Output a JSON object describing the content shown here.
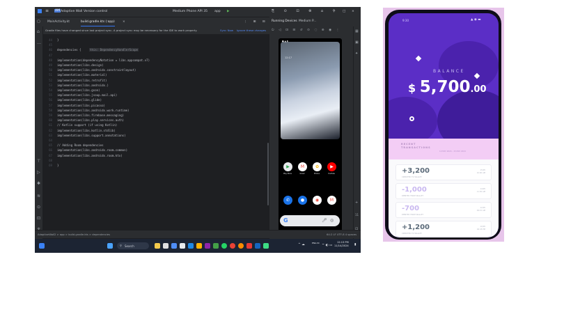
{
  "ide": {
    "titlebar": {
      "project_badge": "AM",
      "project_name": "Adaptive Wall",
      "vcs": "Version control",
      "device": "Medium Phone API 35",
      "run_config": "app"
    },
    "tabs": [
      {
        "label": "MainActivity.kt"
      },
      {
        "label": "build.gradle.kts (:app)"
      }
    ],
    "notification": {
      "message": "Gradle files have changed since last project sync. A project sync may be necessary for the IDE to work properly.",
      "sync_now": "Sync Now",
      "ignore": "Ignore these changes"
    },
    "code": [
      {
        "n": "44",
        "t": "}"
      },
      {
        "n": "45",
        "t": ""
      },
      {
        "n": "46",
        "t": "dependencies {",
        "hint": "this: DependencyHandlerScope"
      },
      {
        "n": "47",
        "t": ""
      },
      {
        "n": "48",
        "t": "    implementation(dependencyNotation = libs.appcompat.v7)"
      },
      {
        "n": "49",
        "t": "    implementation(libs.design)"
      },
      {
        "n": "50",
        "t": "    implementation(libs.androidx.constraintlayout)"
      },
      {
        "n": "51",
        "t": "    implementation(libs.material)"
      },
      {
        "n": "52",
        "t": "    implementation(libs.retrofit)"
      },
      {
        "n": "53",
        "t": "    implementation(libs.androidx.)"
      },
      {
        "n": "54",
        "t": "    implementation(libs.gson)"
      },
      {
        "n": "55",
        "t": "    implementation(libs.jsoup.mail.api)"
      },
      {
        "n": "56",
        "t": "    implementation(libs.glide)"
      },
      {
        "n": "57",
        "t": "    implementation(libs.picasso)"
      },
      {
        "n": "58",
        "t": "    implementation(libs.androidx.work.runtime)"
      },
      {
        "n": "59",
        "t": "    implementation(libs.firebase.messaging)"
      },
      {
        "n": "60",
        "t": "    implementation(libs.play.services.auth)"
      },
      {
        "n": "61",
        "t": "    // Kotlin support (if using Kotlin)"
      },
      {
        "n": "62",
        "t": "    implementation(libs.kotlin.stdlib)"
      },
      {
        "n": "63",
        "t": "    implementation(libs.support.annotations)"
      },
      {
        "n": "64",
        "t": ""
      },
      {
        "n": "65",
        "t": "    // Adding Room dependencies"
      },
      {
        "n": "66",
        "t": "    implementation(libs.androidx.room.common)"
      },
      {
        "n": "67",
        "t": "    implementation(libs.androidx.room.ktx)"
      },
      {
        "n": "68",
        "t": ""
      },
      {
        "n": "69",
        "t": "}"
      }
    ],
    "running_devices": {
      "label": "Running Devices",
      "device_tab": "Medium P..."
    },
    "emulator": {
      "clock": "12:17",
      "apps_row1": [
        {
          "label": "Play Store",
          "color": "#e8eaed"
        },
        {
          "label": "Gmail",
          "color": "#ffffff"
        },
        {
          "label": "Photos",
          "color": "#ffffff"
        },
        {
          "label": "YouTube",
          "color": "#ff0000"
        }
      ],
      "apps_row2": [
        {
          "label": "Phone",
          "color": "#1a73e8"
        },
        {
          "label": "Messages",
          "color": "#1a73e8"
        },
        {
          "label": "Chrome",
          "color": "#ffffff"
        },
        {
          "label": "Gmail",
          "color": "#ffffff"
        }
      ],
      "search_letter": "G"
    },
    "statusbar": {
      "path": "AdaptiveWall2 > app > build.gradle.kts > dependencies",
      "right": "64:2   LF   UTF-8   4 spaces"
    },
    "taskbar": {
      "search": "Search",
      "language": "ENG IN",
      "time": "12:13 PM",
      "date": "11/14/2024"
    }
  },
  "phone": {
    "balance_label": "BALANCE",
    "currency": "$",
    "amount_main": "5,700",
    "amount_cents": ".00",
    "recent_title_1": "RECENT",
    "recent_title_2": "TRANSACTIONS",
    "recent_sub": "10 MAY 2024 - 15 MAY 2024",
    "transactions": [
      {
        "amount": "+3,200",
        "desc": "CREDITED TO WALLET",
        "date": "15/05",
        "time": "10:00 AM",
        "color": "#5c6b7a"
      },
      {
        "amount": "-1,000",
        "desc": "DEBITED FROM WALLET",
        "date": "14/05",
        "time": "11:30 AM",
        "color": "#c9b8f0"
      },
      {
        "amount": "-700",
        "desc": "DEBITED FROM WALLET",
        "date": "12/05",
        "time": "09:15 AM",
        "color": "#c9b8f0"
      },
      {
        "amount": "+1,200",
        "desc": "CREDITED TO WALLET",
        "date": "10/05",
        "time": "04:45 PM",
        "color": "#5c6b7a"
      }
    ],
    "colors": {
      "primary": "#5b2ec6",
      "accent_pink": "#f3cdf5"
    }
  }
}
